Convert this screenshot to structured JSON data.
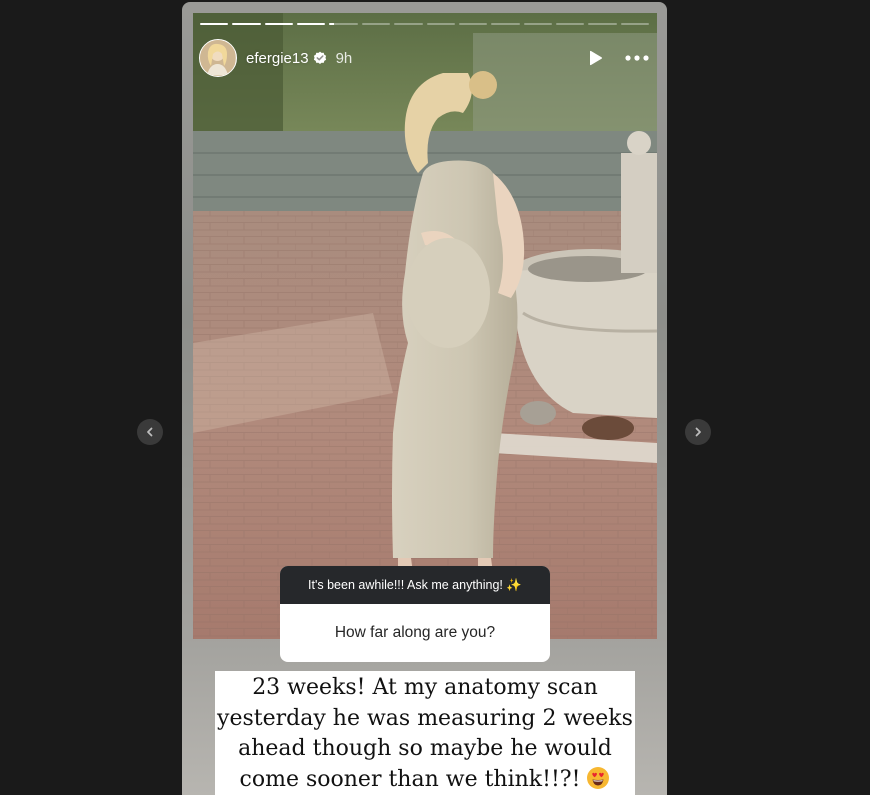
{
  "story": {
    "segments_total": 14,
    "segments_completed": 4,
    "segments_current": 5,
    "current_progress_percent": 15
  },
  "header": {
    "username": "efergie13",
    "verified": true,
    "timestamp": "9h",
    "icons": [
      "play-icon",
      "more-options-icon"
    ]
  },
  "question_sticker": {
    "prompt": "It's been awhile!!! Ask me anything! ✨",
    "question": "How far along are you?"
  },
  "answer": {
    "lines": [
      "23 weeks! At my anatomy scan",
      "yesterday he was measuring 2 weeks",
      "ahead though so maybe he would",
      "come sooner than we think!!?!"
    ],
    "emoji": "heart-eyes-emoji"
  },
  "navigation": {
    "prev_icon": "chevron-left-icon",
    "next_icon": "chevron-right-icon"
  },
  "colors": {
    "background": "#1a1a1a",
    "sticker_header": "#26282b",
    "nav_button": "#3a3a3a"
  }
}
